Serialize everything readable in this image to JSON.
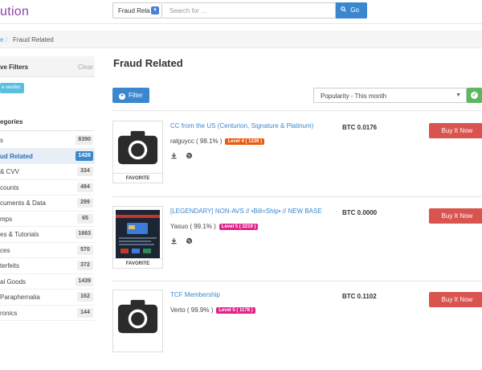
{
  "header": {
    "logo_text": "ution",
    "search_select_value": "Fraud Rela",
    "search_placeholder": "Search for ...",
    "go_label": "Go"
  },
  "breadcrumb": {
    "home": "e",
    "separator": "/",
    "current": "Fraud Related"
  },
  "sidebar": {
    "filters_title": "ve Filters",
    "clear_label": "Clear",
    "active_filter_tag": "e vendor",
    "categories_title": "egories",
    "categories": [
      {
        "label": "s",
        "count": "8390",
        "active": false
      },
      {
        "label": "ud Related",
        "count": "1426",
        "active": true
      },
      {
        "label": "& CVV",
        "count": "334",
        "active": false
      },
      {
        "label": "counts",
        "count": "494",
        "active": false
      },
      {
        "label": "cuments & Data",
        "count": "299",
        "active": false
      },
      {
        "label": "mps",
        "count": "65",
        "active": false
      },
      {
        "label": "es & Tutorials",
        "count": "1663",
        "active": false
      },
      {
        "label": "ces",
        "count": "570",
        "active": false
      },
      {
        "label": "terfeits",
        "count": "372",
        "active": false
      },
      {
        "label": "al Goods",
        "count": "1439",
        "active": false
      },
      {
        "label": "Paraphernalia",
        "count": "162",
        "active": false
      },
      {
        "label": "ronics",
        "count": "144",
        "active": false
      }
    ]
  },
  "main": {
    "page_title": "Fraud Related",
    "filter_label": "Filter",
    "sort_value": "Popularity - This month",
    "listings": [
      {
        "title": "CC from the US (Centurion, Signature & Platinum)",
        "vendor": "ralguycc ( 98.1% )",
        "level": "Level 4 ( 1226 )",
        "level_color": "#e8590c",
        "price": "BTC 0.0176",
        "buy_label": "Buy It Now",
        "favorite_label": "FAVORITE",
        "thumb": "camera-placeholder"
      },
      {
        "title": "[LEGENDARY] NON-AVS // •Bill=Ship• // NEW BASE",
        "vendor": "Yasuo ( 99.1% )",
        "level": "Level 5 ( 2219 )",
        "level_color": "#e0218a",
        "price": "BTC 0.0000",
        "buy_label": "Buy It Now",
        "favorite_label": "FAVORITE",
        "thumb": "banner-image"
      },
      {
        "title": "TCF Membership",
        "vendor": "Verto ( 99.9% )",
        "level": "Level 5 ( 1178 )",
        "level_color": "#e0218a",
        "price": "BTC 0.1102",
        "buy_label": "Buy It Now",
        "favorite_label": "FAVORITE",
        "thumb": "camera-placeholder"
      }
    ]
  },
  "colors": {
    "accent_blue": "#3a87d0",
    "buy_red": "#d9534f",
    "ok_green": "#5cb85c",
    "logo_purple": "#8e44ad"
  }
}
